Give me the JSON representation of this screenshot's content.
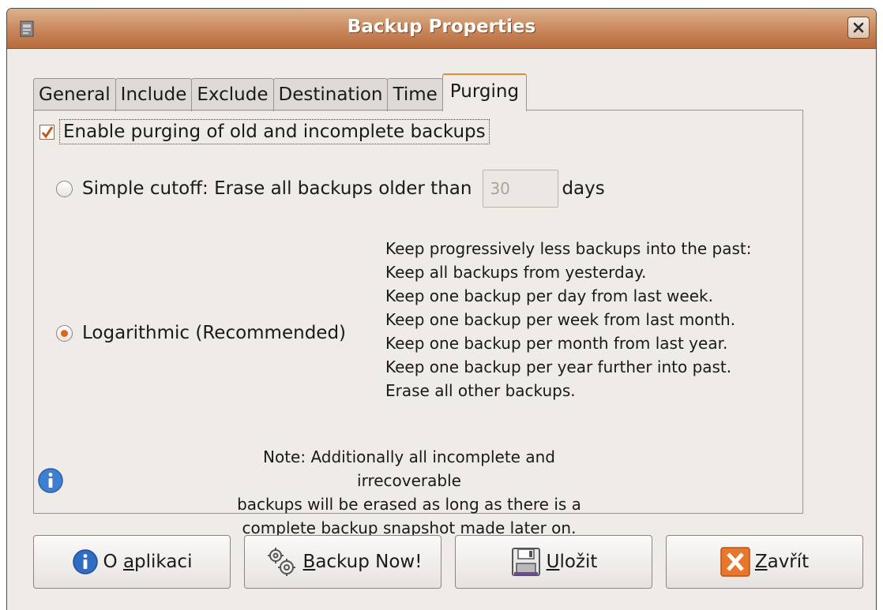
{
  "window": {
    "title": "Backup Properties"
  },
  "tabs": [
    {
      "label": "General",
      "active": false
    },
    {
      "label": "Include",
      "active": false
    },
    {
      "label": "Exclude",
      "active": false
    },
    {
      "label": "Destination",
      "active": false
    },
    {
      "label": "Time",
      "active": false
    },
    {
      "label": "Purging",
      "active": true
    }
  ],
  "purging": {
    "enable_label": "Enable purging of old and incomplete backups",
    "enable_checked": true,
    "simple_label": "Simple cutoff: Erase all backups older than",
    "simple_days_value": "30",
    "simple_days_unit": "days",
    "simple_selected": false,
    "log_label": "Logarithmic (Recommended)",
    "log_selected": true,
    "log_description": [
      "Keep progressively less backups into the past:",
      "Keep all backups from yesterday.",
      "Keep one backup per day from last week.",
      "Keep one backup per week from last month.",
      "Keep one backup per month from last year.",
      "Keep one backup per year further into past.",
      "Erase all other backups."
    ],
    "note": [
      "Note: Additionally all incomplete and irrecoverable",
      "backups will be erased as long as there is a",
      "complete backup snapshot made later on."
    ]
  },
  "buttons": {
    "about": {
      "mnemonic": "",
      "pre": "O ",
      "under": "a",
      "post": "plikaci"
    },
    "backup_now": {
      "pre": "",
      "under": "B",
      "post": "ackup Now!"
    },
    "save": {
      "pre": "",
      "under": "U",
      "post": "ložit"
    },
    "close": {
      "pre": "",
      "under": "Z",
      "post": "avřít"
    }
  },
  "colors": {
    "accent": "#d9681d",
    "title_bar": "#c9865a",
    "background": "#efebe7"
  }
}
